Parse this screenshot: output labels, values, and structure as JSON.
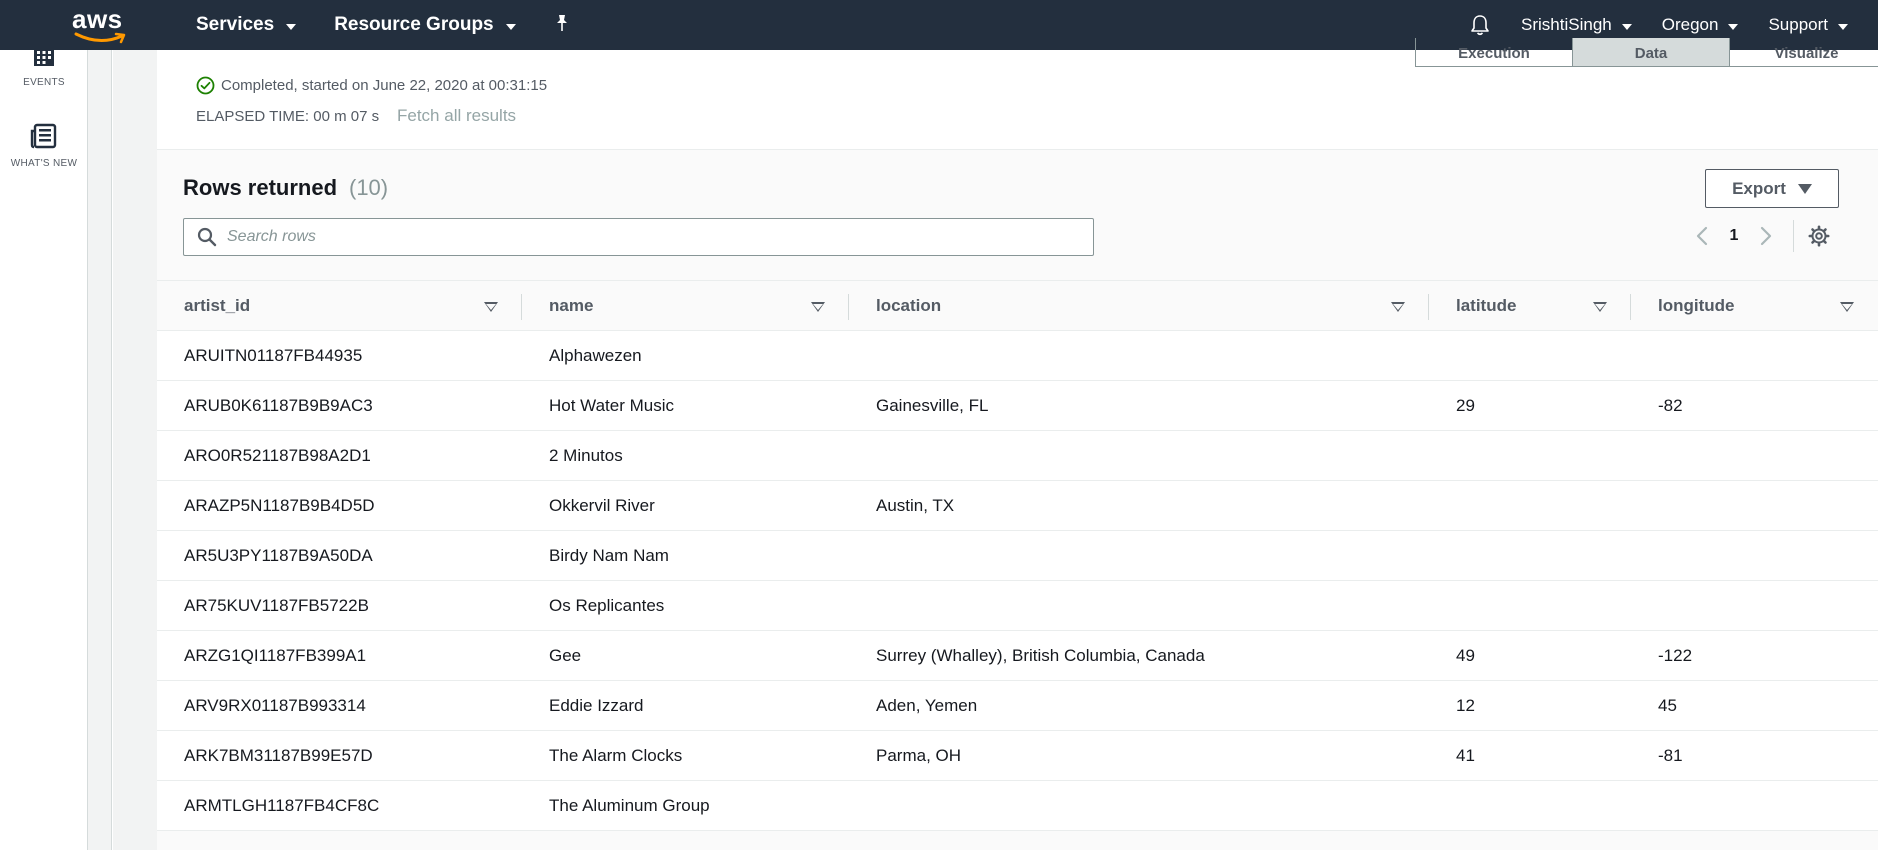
{
  "topnav": {
    "logo_text": "aws",
    "services_label": "Services",
    "resource_groups_label": "Resource Groups",
    "user_label": "SrishtiSingh",
    "region_label": "Oregon",
    "support_label": "Support"
  },
  "rail": {
    "events_label": "EVENTS",
    "whats_new_label": "WHAT'S NEW"
  },
  "status": {
    "completed_text": "Completed, started on June 22, 2020 at 00:31:15",
    "elapsed_text": "ELAPSED TIME: 00 m 07 s",
    "fetch_all_label": "Fetch all results",
    "tabs": [
      "Execution",
      "Data",
      "Visualize"
    ],
    "selected_tab": "Data"
  },
  "rows": {
    "title": "Rows returned",
    "count": "(10)",
    "export_label": "Export",
    "search_placeholder": "Search rows",
    "page_number": "1"
  },
  "table": {
    "columns": [
      "artist_id",
      "name",
      "location",
      "latitude",
      "longitude"
    ],
    "rows": [
      {
        "artist_id": "ARUITN01187FB44935",
        "name": "Alphawezen",
        "location": "",
        "latitude": "",
        "longitude": ""
      },
      {
        "artist_id": "ARUB0K61187B9B9AC3",
        "name": "Hot Water Music",
        "location": "Gainesville, FL",
        "latitude": "29",
        "longitude": "-82"
      },
      {
        "artist_id": "ARO0R521187B98A2D1",
        "name": "2 Minutos",
        "location": "",
        "latitude": "",
        "longitude": ""
      },
      {
        "artist_id": "ARAZP5N1187B9B4D5D",
        "name": "Okkervil River",
        "location": "Austin, TX",
        "latitude": "",
        "longitude": ""
      },
      {
        "artist_id": "AR5U3PY1187B9A50DA",
        "name": "Birdy Nam Nam",
        "location": "",
        "latitude": "",
        "longitude": ""
      },
      {
        "artist_id": "AR75KUV1187FB5722B",
        "name": "Os Replicantes",
        "location": "",
        "latitude": "",
        "longitude": ""
      },
      {
        "artist_id": "ARZG1QI1187FB399A1",
        "name": "Gee",
        "location": "Surrey (Whalley), British Columbia, Canada",
        "latitude": "49",
        "longitude": "-122"
      },
      {
        "artist_id": "ARV9RX01187B993314",
        "name": "Eddie Izzard",
        "location": "Aden, Yemen",
        "latitude": "12",
        "longitude": "45"
      },
      {
        "artist_id": "ARK7BM31187B99E57D",
        "name": "The Alarm Clocks",
        "location": "Parma, OH",
        "latitude": "41",
        "longitude": "-81"
      },
      {
        "artist_id": "ARMTLGH1187FB4CF8C",
        "name": "The Aluminum Group",
        "location": "",
        "latitude": "",
        "longitude": ""
      }
    ]
  },
  "colors": {
    "nav_bg": "#232f3e",
    "success_green": "#1d8102",
    "text_secondary": "#545b64"
  }
}
